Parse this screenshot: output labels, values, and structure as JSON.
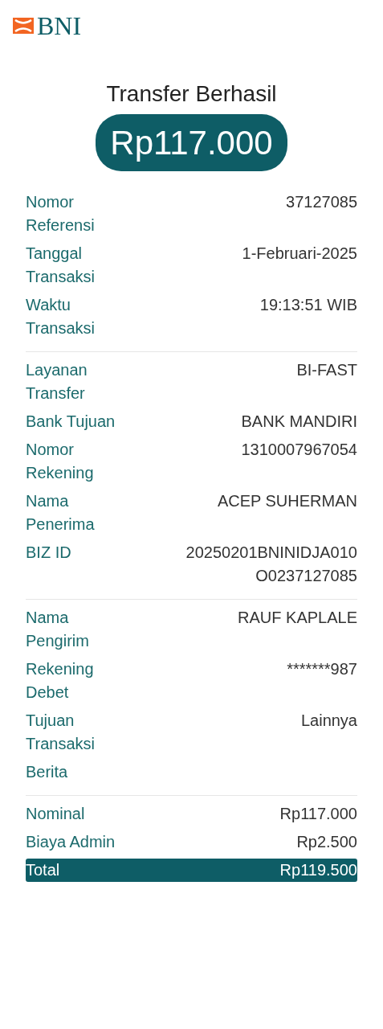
{
  "logo": {
    "text": "BNI"
  },
  "title": "Transfer Berhasil",
  "amount": "Rp117.000",
  "sections": [
    {
      "rows": [
        {
          "label": "Nomor Referensi",
          "value": "37127085"
        },
        {
          "label": "Tanggal Transaksi",
          "value": "1-Februari-2025"
        },
        {
          "label": "Waktu Transaksi",
          "value": "19:13:51 WIB"
        }
      ]
    },
    {
      "rows": [
        {
          "label": "Layanan Transfer",
          "value": "BI-FAST"
        },
        {
          "label": "Bank Tujuan",
          "value": "BANK MANDIRI"
        },
        {
          "label": "Nomor Rekening",
          "value": "1310007967054"
        },
        {
          "label": "Nama Penerima",
          "value": "ACEP SUHERMAN"
        },
        {
          "label": "BIZ ID",
          "value": "20250201BNINIDJA010O0237127085"
        }
      ]
    },
    {
      "rows": [
        {
          "label": "Nama Pengirim",
          "value": "RAUF KAPLALE"
        },
        {
          "label": "Rekening Debet",
          "value": "*******987"
        },
        {
          "label": "Tujuan Transaksi",
          "value": "Lainnya"
        },
        {
          "label": "Berita"
        }
      ]
    },
    {
      "rows": [
        {
          "label": "Nominal",
          "value": "Rp117.000"
        },
        {
          "label": "Biaya Admin",
          "value": "Rp2.500"
        },
        {
          "label": "Total",
          "value": "Rp119.500",
          "highlighted": true
        }
      ]
    }
  ]
}
